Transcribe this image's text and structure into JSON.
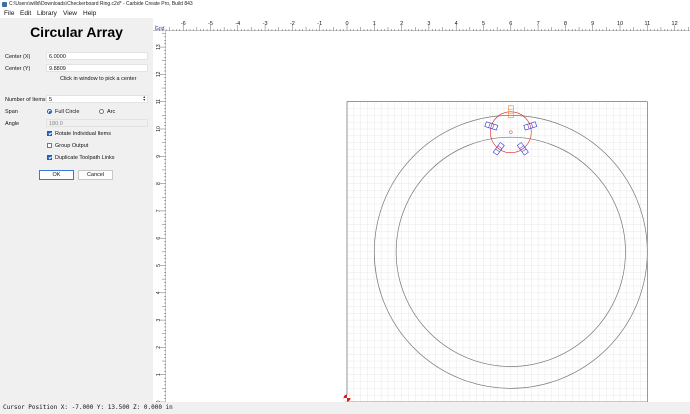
{
  "window": {
    "title": "C:\\Users\\willd\\Downloads\\Checkerboard Ring.c2d* - Carbide Create Pro, Build 843"
  },
  "menu": [
    "File",
    "Edit",
    "Library",
    "View",
    "Help"
  ],
  "panel": {
    "title": "Circular Array",
    "center_x": {
      "label": "Center (X)",
      "value": "6.0000"
    },
    "center_y": {
      "label": "Center (Y)",
      "value": "9.8809"
    },
    "pick_hint": "Click in window to pick a center",
    "items": {
      "label": "Number of Items",
      "value": "5"
    },
    "span": {
      "label": "Span",
      "options": [
        "Full Circle",
        "Arc"
      ],
      "selected": "Full Circle"
    },
    "angle": {
      "label": "Angle",
      "value": "180.0"
    },
    "options": [
      {
        "label": "Rotate Individual Items",
        "checked": true
      },
      {
        "label": "Group Output",
        "checked": false
      },
      {
        "label": "Duplicate Toolpath Links",
        "checked": true
      }
    ],
    "ok_label": "OK",
    "cancel_label": "Cancel"
  },
  "canvas": {
    "grid_label": "Grid",
    "x_ticks": [
      "-6",
      "-5",
      "-4",
      "-3",
      "-2",
      "-1",
      "0",
      "1",
      "2",
      "3",
      "4",
      "5",
      "6",
      "7",
      "8",
      "9",
      "10",
      "11",
      "12"
    ],
    "y_ticks": [
      "13",
      "12",
      "11",
      "10",
      "9",
      "8",
      "7",
      "6",
      "5",
      "4",
      "3",
      "2",
      "1",
      "0"
    ],
    "stock_width": 11,
    "stock_height": 11,
    "outer_ring_radius": 5,
    "inner_ring_radius": 4.2,
    "ring_center": [
      6,
      5.5
    ],
    "array_center": [
      6,
      9.8809
    ],
    "array_radius": 0.75,
    "item_count": 5,
    "colors": {
      "grid": "#e2e2e2",
      "ring": "#777777",
      "item": "#2b2bd6",
      "selected": "#ff7f1a",
      "array_circle": "#e02020"
    }
  },
  "status": {
    "text": "Cursor Position X: -7.000 Y: 13.500 Z: 0.000 in"
  }
}
